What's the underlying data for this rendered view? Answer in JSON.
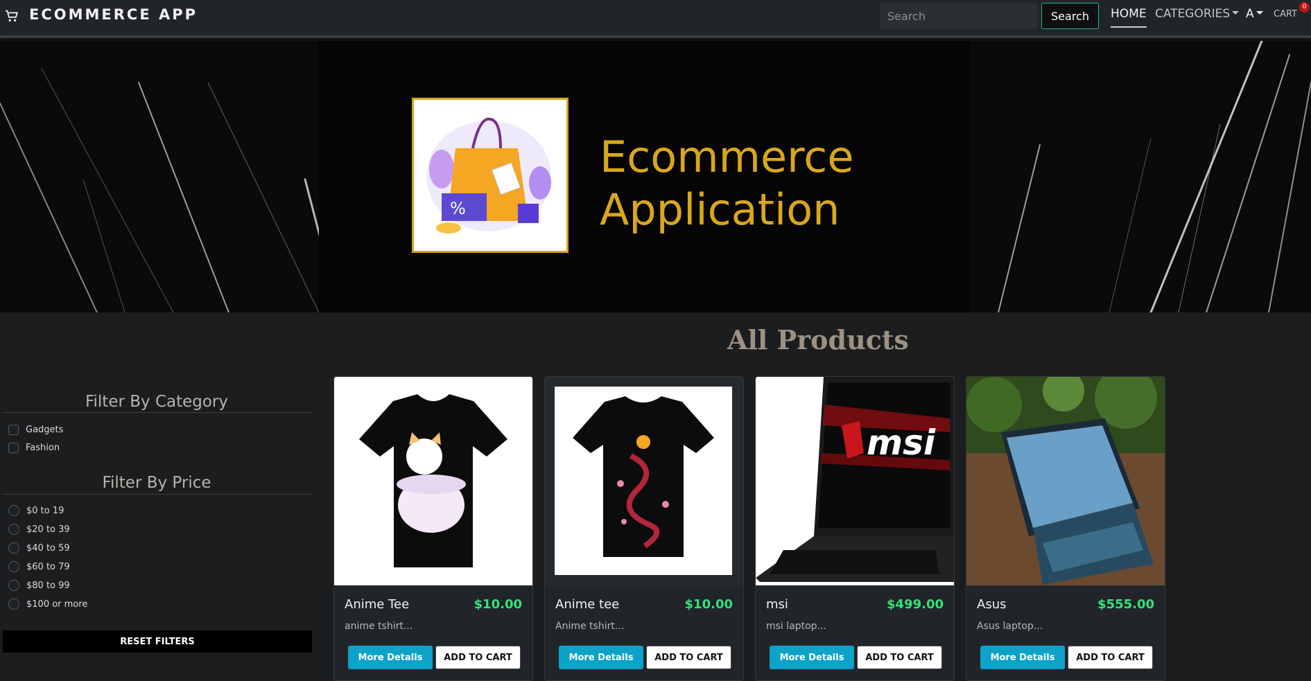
{
  "header": {
    "brand": "ECOMMERCE APP",
    "search_placeholder": "Search",
    "search_button": "Search",
    "nav": {
      "home": "HOME",
      "categories": "CATEGORIES",
      "user": "A",
      "cart": "CART"
    },
    "cart_count": "0"
  },
  "banner": {
    "title_line1": "Ecommerce",
    "title_line2": "Application"
  },
  "sidebar": {
    "category_title": "Filter By Category",
    "categories": [
      "Gadgets",
      "Fashion"
    ],
    "price_title": "Filter By Price",
    "prices": [
      "$0 to 19",
      "$20 to 39",
      "$40 to 59",
      "$60 to 79",
      "$80 to 99",
      "$100 or more"
    ],
    "reset_label": "RESET FILTERS"
  },
  "main": {
    "heading": "All Products",
    "products": [
      {
        "name": "Anime Tee",
        "price": "$10.00",
        "desc": "anime tshirt...",
        "more_label": "More Details",
        "cart_label": "ADD TO CART"
      },
      {
        "name": "Anime tee",
        "price": "$10.00",
        "desc": "Anime tshirt...",
        "more_label": "More Details",
        "cart_label": "ADD TO CART"
      },
      {
        "name": "msi",
        "price": "$499.00",
        "desc": "msi laptop...",
        "more_label": "More Details",
        "cart_label": "ADD TO CART",
        "image_text": "msi"
      },
      {
        "name": "Asus",
        "price": "$555.00",
        "desc": "Asus laptop...",
        "more_label": "More Details",
        "cart_label": "ADD TO CART"
      }
    ]
  },
  "colors": {
    "accent_gold": "#d9a71d",
    "price_green": "#36e07a",
    "info_blue": "#0da2c8",
    "badge_red": "#c0151a"
  }
}
